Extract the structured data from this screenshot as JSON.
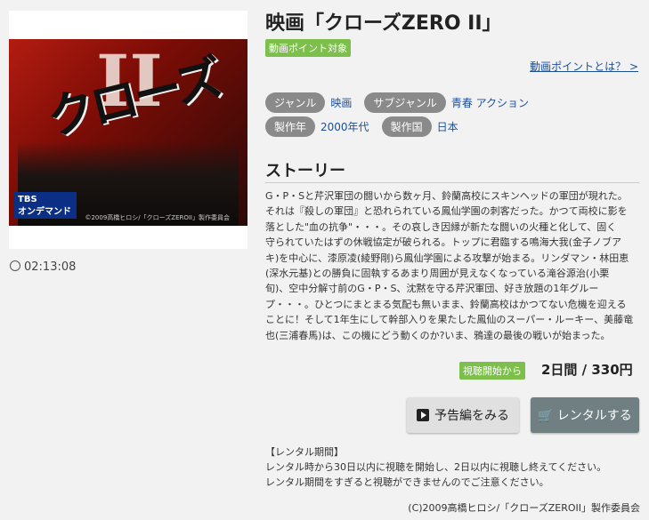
{
  "movie": {
    "title": "映画「クローズZERO II」",
    "point_badge": "動画ポイント対象",
    "point_link": "動画ポイントとは？ >",
    "duration": "02:13:08"
  },
  "poster": {
    "title_text": "クローズ",
    "roman": "II",
    "broadcaster": "TBS",
    "broadcaster_sub": "オンデマンド",
    "copyright": "©2009高橋ヒロシ/「クローズZEROII」製作委員会"
  },
  "meta": {
    "genre_label": "ジャンル",
    "genre_value": "映画",
    "subgenre_label": "サブジャンル",
    "subgenre_value": "青春 アクション",
    "year_label": "製作年",
    "year_value": "2000年代",
    "country_label": "製作国",
    "country_value": "日本"
  },
  "story": {
    "heading": "ストーリー",
    "lines": [
      "G・P・Sと芹沢軍団の闘いから数ヶ月、鈴蘭高校にスキンヘッドの軍団が現れた。",
      "それは『殺しの軍団』と恐れられている鳳仙学園の刺客だった。かつて両校に影を",
      "落とした\"血の抗争\"・・・。その哀しき因縁が新たな闘いの火種と化して、固く",
      "守られていたはずの休戦協定が破られる。トップに君臨する鳴海大我(金子ノブア",
      "キ)を中心に、漆原凌(綾野剛)ら鳳仙学園による攻撃が始まる。リンダマン・林田恵",
      "(深水元基)との勝負に固執するあまり周囲が見えなくなっている滝谷源治(小栗",
      "旬)、空中分解寸前のG・P・S、沈黙を守る芹沢軍団、好き放題の1年グルー",
      "プ・・・。ひとつにまとまる気配も無いまま、鈴蘭高校はかつてない危機を迎える",
      "ことに！そして1年生にして幹部入りを果たした鳳仙のスーパー・ルーキー、美藤竜",
      "也(三浦春馬)は、この機にどう動くのか?いま、鴉達の最後の戦いが始まった。"
    ]
  },
  "rental": {
    "badge": "視聴開始から",
    "price": "2日間 / 330円",
    "trailer_button": "予告編をみる",
    "rent_button": "レンタルする",
    "note_title": "【レンタル期間】",
    "note_line1": "レンタル時から30日以内に視聴を開始し、2日以内に視聴し終えてください。",
    "note_line2": "レンタル期間をすぎると視聴ができませんのでご注意ください。"
  },
  "footer": {
    "copyright": "(C)2009高橋ヒロシ/「クローズZEROII」製作委員会"
  }
}
